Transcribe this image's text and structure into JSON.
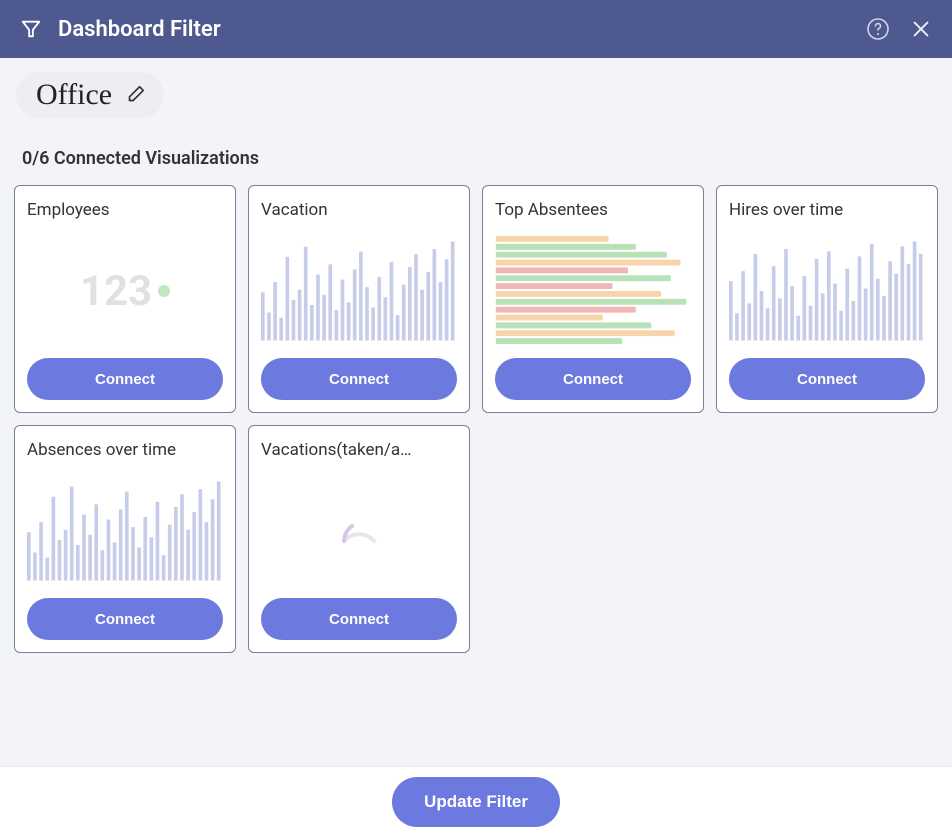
{
  "header": {
    "title": "Dashboard Filter",
    "icons": {
      "filter": "filter-icon",
      "help": "help-icon",
      "close": "close-icon"
    }
  },
  "filter": {
    "name": "Office",
    "edit_icon": "pencil-icon"
  },
  "status_text": "0/6 Connected Visualizations",
  "connect_label": "Connect",
  "cards": [
    {
      "title": "Employees",
      "type": "kpi",
      "kpi_value": "123"
    },
    {
      "title": "Vacation",
      "type": "bars"
    },
    {
      "title": "Top Absentees",
      "type": "hbars"
    },
    {
      "title": "Hires over time",
      "type": "bars"
    },
    {
      "title": "Absences over time",
      "type": "bars"
    },
    {
      "title": "Vacations(taken/a…",
      "type": "spinner"
    }
  ],
  "footer": {
    "update_label": "Update Filter"
  },
  "chart_data": [
    {
      "type": "kpi",
      "title": "Employees",
      "value": 123
    },
    {
      "type": "bar",
      "title": "Vacation",
      "categories": [],
      "values": [
        38,
        22,
        46,
        18,
        66,
        32,
        40,
        74,
        28,
        52,
        36,
        60,
        24,
        48,
        30,
        56,
        70,
        42,
        26,
        50,
        34,
        62,
        20,
        44,
        58,
        68,
        40,
        54,
        72,
        46,
        64,
        78
      ],
      "xlabel": "",
      "ylabel": ""
    },
    {
      "type": "bar-horizontal",
      "title": "Top Absentees",
      "series": [
        {
          "color": "#f3b26b",
          "value": 58
        },
        {
          "color": "#7fc97f",
          "value": 72
        },
        {
          "color": "#7fc97f",
          "value": 88
        },
        {
          "color": "#f3b26b",
          "value": 95
        },
        {
          "color": "#e77d7d",
          "value": 68
        },
        {
          "color": "#7fc97f",
          "value": 90
        },
        {
          "color": "#e77d7d",
          "value": 60
        },
        {
          "color": "#f3b26b",
          "value": 85
        },
        {
          "color": "#7fc97f",
          "value": 98
        },
        {
          "color": "#e77d7d",
          "value": 72
        },
        {
          "color": "#f3b26b",
          "value": 55
        },
        {
          "color": "#7fc97f",
          "value": 80
        },
        {
          "color": "#f3b26b",
          "value": 92
        },
        {
          "color": "#7fc97f",
          "value": 65
        }
      ]
    },
    {
      "type": "bar",
      "title": "Hires over time",
      "categories": [],
      "values": [
        48,
        22,
        56,
        30,
        70,
        40,
        26,
        60,
        34,
        74,
        44,
        20,
        52,
        28,
        66,
        38,
        72,
        46,
        24,
        58,
        32,
        68,
        42,
        78,
        50,
        36,
        64,
        54,
        76,
        62,
        80,
        70
      ],
      "xlabel": "",
      "ylabel": ""
    },
    {
      "type": "bar",
      "title": "Absences over time",
      "categories": [],
      "values": [
        38,
        22,
        46,
        18,
        66,
        32,
        40,
        74,
        28,
        52,
        36,
        60,
        24,
        48,
        30,
        56,
        70,
        42,
        26,
        50,
        34,
        62,
        20,
        44,
        58,
        68,
        40,
        54,
        72,
        46,
        64,
        78
      ],
      "xlabel": "",
      "ylabel": ""
    },
    {
      "type": "loading",
      "title": "Vacations(taken/a…"
    }
  ]
}
